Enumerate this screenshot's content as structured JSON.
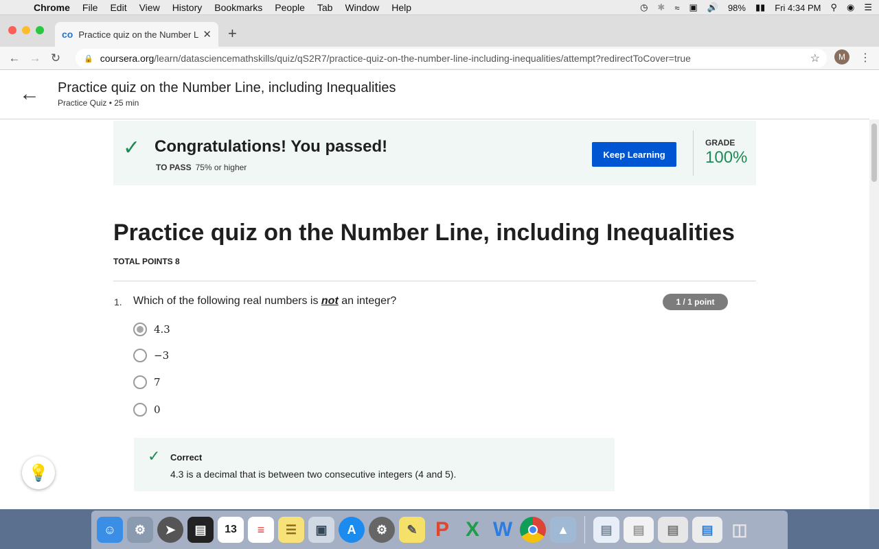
{
  "menubar": {
    "apple_icon": "",
    "items": [
      "Chrome",
      "File",
      "Edit",
      "View",
      "History",
      "Bookmarks",
      "People",
      "Tab",
      "Window",
      "Help"
    ],
    "battery": "98%",
    "clock": "Fri 4:34 PM"
  },
  "browser": {
    "tab_title": "Practice quiz on the Number Li",
    "tab_favicon": "co",
    "url_host": "coursera.org",
    "url_path": "/learn/datasciencemathskills/quiz/qS2R7/practice-quiz-on-the-number-line-including-inequalities/attempt?redirectToCover=true",
    "profile_initial": "M"
  },
  "header": {
    "title": "Practice quiz on the Number Line, including Inequalities",
    "subtitle": "Practice Quiz • 25 min"
  },
  "result": {
    "heading": "Congratulations! You passed!",
    "to_pass_label": "TO PASS",
    "to_pass_value": "75% or higher",
    "keep_learning": "Keep Learning",
    "grade_label": "GRADE",
    "grade_value": "100%"
  },
  "quiz": {
    "title": "Practice quiz on the Number Line, including Inequalities",
    "total_points": "TOTAL POINTS 8"
  },
  "question1": {
    "number": "1.",
    "text_before": "Which of the following real numbers is ",
    "text_emph": "not",
    "text_after": " an integer?",
    "points": "1 / 1 point",
    "options": [
      "4.3",
      "−3",
      "7",
      "0"
    ],
    "selected_index": 0,
    "feedback_title": "Correct",
    "feedback_body": "4.3 is a decimal that is between two consecutive integers (4 and 5)."
  },
  "colors": {
    "accent_blue": "#0056d2",
    "success_green": "#1e8a55",
    "banner_bg": "#f0f7f4"
  },
  "icons": {
    "back": "back-arrow-icon",
    "check": "checkmark-icon",
    "bulb": "lightbulb-icon"
  },
  "dock_apps": [
    "Finder",
    "Network Utility",
    "Launchpad",
    "Activity",
    "Calendar",
    "Reminders",
    "Notes",
    "Preview",
    "App Store",
    "System Preferences",
    "Stickies",
    "PowerPoint",
    "Excel",
    "Word",
    "Chrome",
    "Photos",
    "Documents",
    "Chrome Window",
    "Screen",
    "Word Doc",
    "Trash"
  ]
}
